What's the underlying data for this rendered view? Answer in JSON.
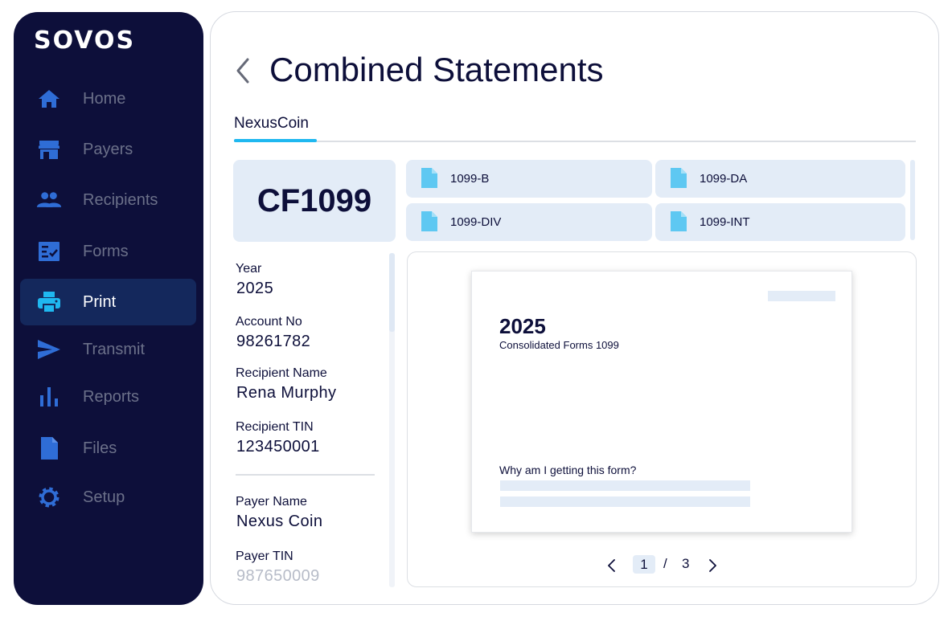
{
  "brand": {
    "name": "SOVOS"
  },
  "sidebar": {
    "items": [
      {
        "label": "Home",
        "icon": "home-icon"
      },
      {
        "label": "Payers",
        "icon": "store-icon"
      },
      {
        "label": "Recipients",
        "icon": "people-icon"
      },
      {
        "label": "Forms",
        "icon": "checklist-icon"
      },
      {
        "label": "Print",
        "icon": "printer-icon",
        "active": true
      },
      {
        "label": "Transmit",
        "icon": "send-icon"
      },
      {
        "label": "Reports",
        "icon": "bar-chart-icon"
      },
      {
        "label": "Files",
        "icon": "file-icon"
      },
      {
        "label": "Setup",
        "icon": "gear-icon"
      }
    ]
  },
  "header": {
    "title": "Combined Statements"
  },
  "tabs": [
    {
      "label": "NexusCoin",
      "active": true
    }
  ],
  "form_code": "CF1099",
  "forms": [
    "1099-B",
    "1099-DA",
    "1099-DIV",
    "1099-INT"
  ],
  "details": {
    "year": {
      "label": "Year",
      "value": "2025"
    },
    "account": {
      "label": "Account No",
      "value": "98261782"
    },
    "recipient_name": {
      "label": "Recipient Name",
      "value": "Rena Murphy"
    },
    "recipient_tin": {
      "label": "Recipient TIN",
      "value": "123450001"
    },
    "payer_name": {
      "label": "Payer Name",
      "value": "Nexus Coin"
    },
    "payer_tin": {
      "label": "Payer TIN",
      "value": "987650009"
    }
  },
  "preview": {
    "year": "2025",
    "subtitle": "Consolidated Forms 1099",
    "question": "Why am I getting this form?"
  },
  "pager": {
    "current": "1",
    "separator": "/",
    "total": "3"
  },
  "colors": {
    "sidebar_bg": "#0d0f3a",
    "active_bg": "#14285c",
    "accent": "#1fb8f0",
    "chip_bg": "#e3ecf7"
  }
}
